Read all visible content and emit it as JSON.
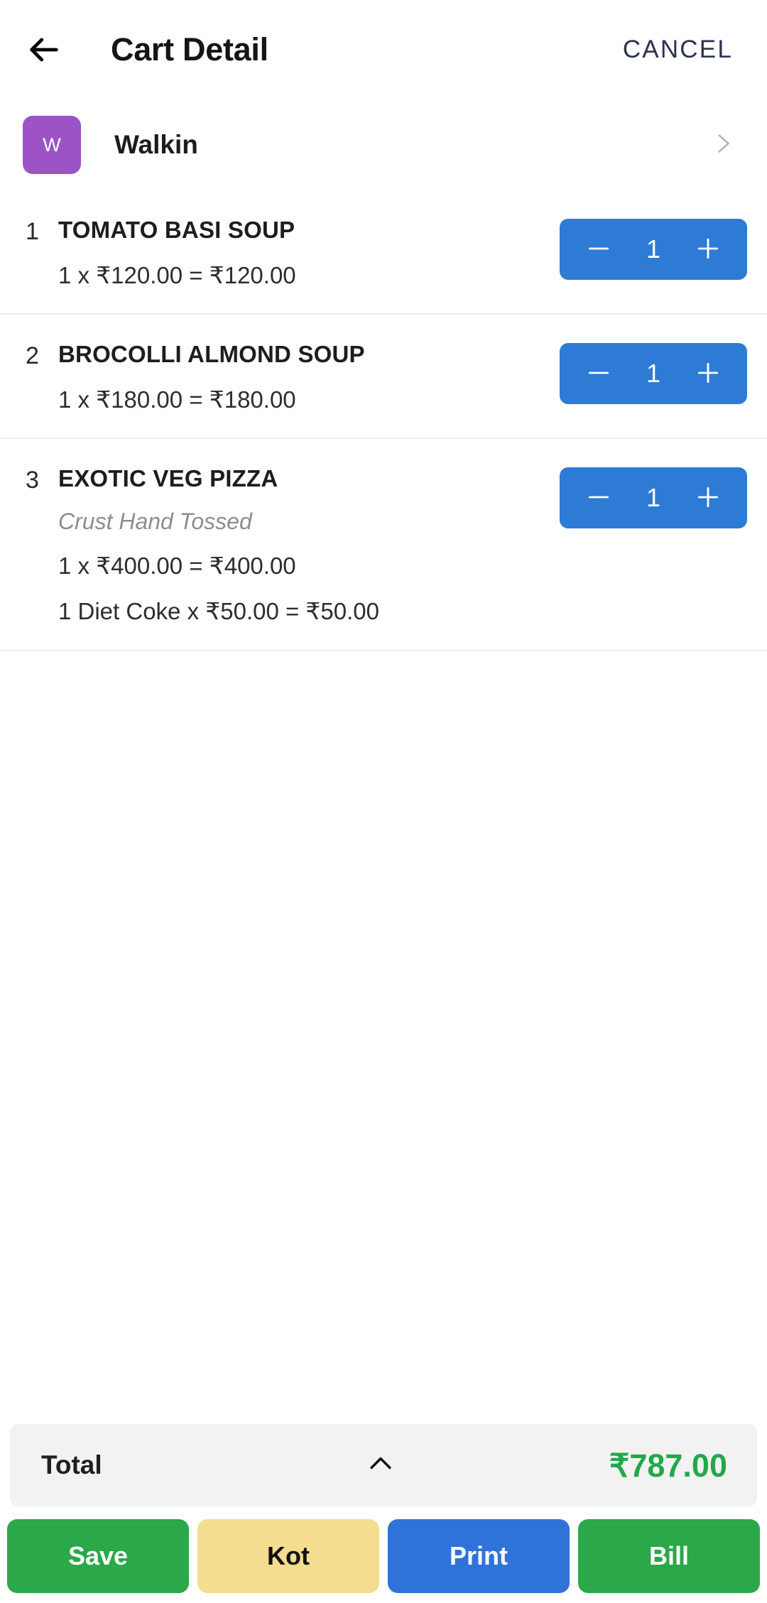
{
  "appbar": {
    "back_icon": "arrow-left-icon",
    "title": "Cart Detail",
    "cancel_label": "CANCEL"
  },
  "customer": {
    "avatar_letter": "W",
    "avatar_color": "#9c53c6",
    "name": "Walkin",
    "chevron_icon": "chevron-right-icon"
  },
  "items": [
    {
      "index": "1",
      "name": "TOMATO BASI SOUP",
      "variant": "",
      "price_line": "1  x ₹120.00  = ₹120.00",
      "addon_line": "",
      "qty": "1"
    },
    {
      "index": "2",
      "name": "BROCOLLI ALMOND SOUP",
      "variant": "",
      "price_line": "1  x ₹180.00  = ₹180.00",
      "addon_line": "",
      "qty": "1"
    },
    {
      "index": "3",
      "name": "EXOTIC VEG PIZZA",
      "variant": "Crust  Hand Tossed",
      "price_line": "1  x ₹400.00  = ₹400.00",
      "addon_line": "1  Diet Coke x  ₹50.00 = ₹50.00",
      "qty": "1"
    }
  ],
  "stepper": {
    "minus_icon": "minus-icon",
    "plus_icon": "plus-icon"
  },
  "total": {
    "label": "Total",
    "toggle_icon": "chevron-up-icon",
    "amount": "₹787.00",
    "amount_color": "#22a84a",
    "bar_color": "#f2f2f2"
  },
  "actions": [
    {
      "label": "Save",
      "color": "#2aa84a",
      "text_color": "#ffffff"
    },
    {
      "label": "Kot",
      "color": "#f4dd90",
      "text_color": "#121212"
    },
    {
      "label": "Print",
      "color": "#2f73d8",
      "text_color": "#ffffff"
    },
    {
      "label": "Bill",
      "color": "#2aa84a",
      "text_color": "#ffffff"
    }
  ]
}
